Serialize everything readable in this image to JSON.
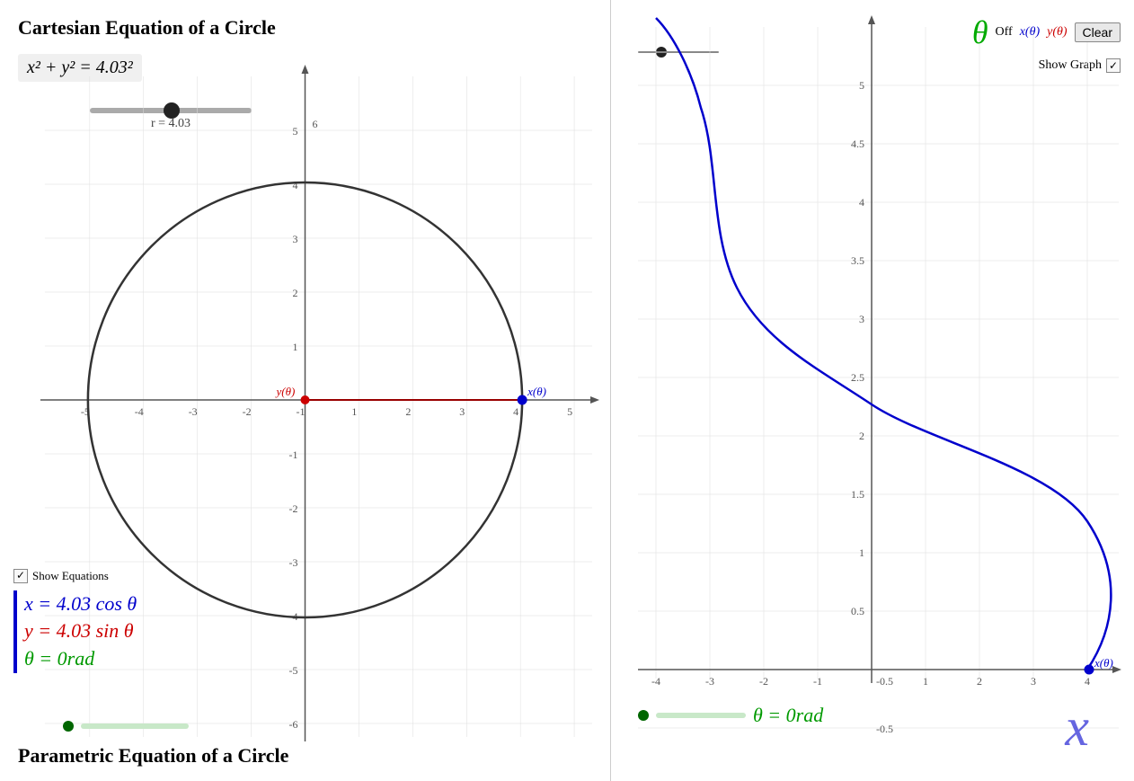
{
  "left": {
    "title": "Cartesian Equation of a Circle",
    "equation": "x² + y² = 4.03²",
    "radius_value": "r = 4.03",
    "show_equations_label": "Show Equations",
    "eq_x": "x = 4.03 cos θ",
    "eq_y": "y = 4.03 sin θ",
    "eq_theta": "θ = 0rad",
    "bottom_title": "Parametric Equation of a Circle",
    "y_theta_label": "y(θ)",
    "x_theta_label": "x(θ)"
  },
  "right": {
    "theta_label": "θ",
    "off_label": "Off",
    "x_theta": "x(θ)",
    "y_theta": "y(θ)",
    "clear_button": "Clear",
    "show_graph_label": "Show Graph",
    "theta_display": "θ = 0rad",
    "x_theta_point": "x(θ)",
    "big_x": "x"
  },
  "colors": {
    "blue": "#0000cc",
    "red": "#cc0000",
    "green": "#009900",
    "dark": "#333333",
    "grid": "#dddddd"
  }
}
